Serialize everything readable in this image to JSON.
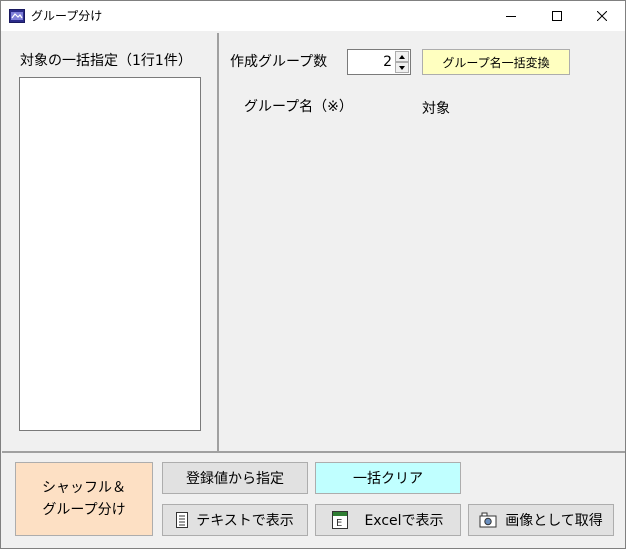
{
  "window": {
    "title": "グループ分け",
    "icon": "app-icon",
    "controls": {
      "minimize": "minimize-icon",
      "maximize": "maximize-icon",
      "close": "close-icon"
    }
  },
  "left": {
    "label": "対象の一括指定（1行1件）",
    "textarea_value": ""
  },
  "right": {
    "group_count_label": "作成グループ数",
    "group_count_value": "2",
    "rename_button": "グループ名一括変換",
    "col_group_name": "グループ名（※）",
    "col_target": "対象"
  },
  "bottom": {
    "shuffle_line1": "シャッフル＆",
    "shuffle_line2": "グループ分け",
    "from_registered": "登録値から指定",
    "clear_all": "一括クリア",
    "show_text": "テキストで表示",
    "show_excel": "Excelで表示",
    "get_image": "画像として取得"
  },
  "colors": {
    "rename_button_bg": "#ffffc0",
    "clear_button_bg": "#c0ffff",
    "shuffle_button_bg": "#fde0c4",
    "default_button_bg": "#e1e1e1"
  }
}
